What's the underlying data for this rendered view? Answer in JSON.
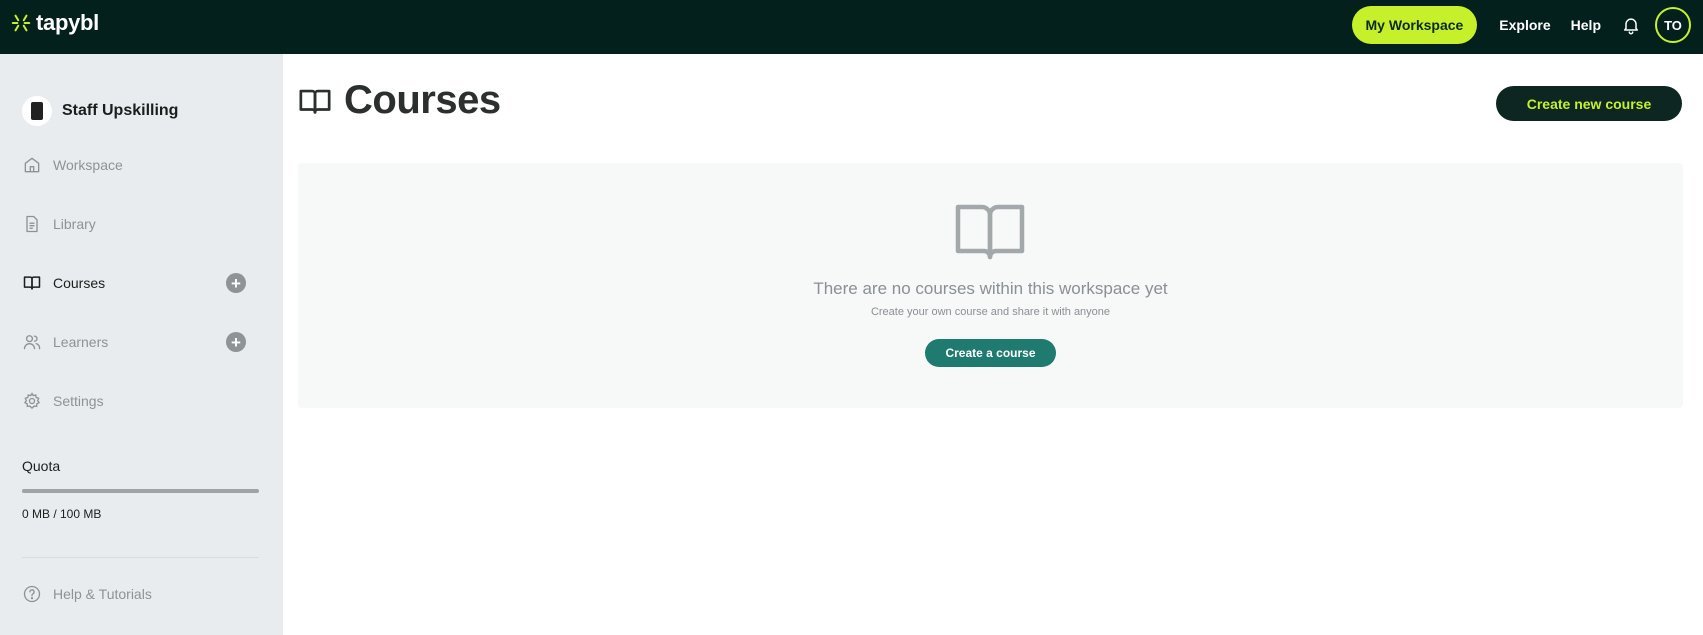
{
  "brand": {
    "name": "tapybl",
    "accent": "#c5f02a",
    "topbar_bg": "#03201d"
  },
  "topnav": {
    "my_workspace": "My Workspace",
    "explore": "Explore",
    "help": "Help",
    "bell_icon": "bell-icon",
    "avatar_initials": "TO"
  },
  "sidebar": {
    "workspace_name": "Staff Upskilling",
    "items": [
      {
        "label": "Workspace",
        "icon": "home-icon",
        "active": false
      },
      {
        "label": "Library",
        "icon": "document-icon",
        "active": false
      },
      {
        "label": "Courses",
        "icon": "book-icon",
        "active": true,
        "add": true
      },
      {
        "label": "Learners",
        "icon": "users-icon",
        "active": false,
        "add": true
      },
      {
        "label": "Settings",
        "icon": "gear-icon",
        "active": false
      }
    ],
    "add_symbol": "+",
    "quota": {
      "label": "Quota",
      "text": "0 MB / 100 MB",
      "used_fraction": 0
    },
    "help": {
      "label": "Help & Tutorials",
      "icon": "question-circle-icon"
    }
  },
  "main": {
    "title": "Courses",
    "title_icon": "book-icon",
    "create_new_button": "Create new course",
    "empty_state": {
      "icon": "book-icon",
      "title": "There are no courses within this workspace yet",
      "subtitle": "Create your own course and share it with anyone",
      "button": "Create a course"
    }
  }
}
